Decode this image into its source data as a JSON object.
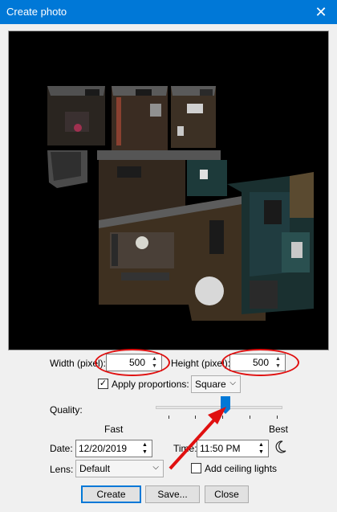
{
  "window": {
    "title": "Create photo",
    "close_glyph": "✕"
  },
  "preview": {
    "description_icon": "3d-floor-plan-render"
  },
  "size": {
    "width_label": "Width (pixel):",
    "width_value": "500",
    "height_label": "Height (pixel):",
    "height_value": "500"
  },
  "proportions": {
    "label": "Apply proportions:",
    "checked": true,
    "check_glyph": "✓",
    "option": "Square"
  },
  "quality": {
    "label": "Quality:",
    "min_label": "Fast",
    "max_label": "Best",
    "level_fraction": 0.55
  },
  "date": {
    "label": "Date:",
    "value": "12/20/2019"
  },
  "time": {
    "label": "Time:",
    "value": "11:50 PM",
    "icon": "moon-icon"
  },
  "lens": {
    "label": "Lens:",
    "value": "Default"
  },
  "ceiling": {
    "label": "Add ceiling lights",
    "checked": false
  },
  "buttons": {
    "create": "Create",
    "save": "Save...",
    "close": "Close"
  },
  "annotation_color": "#e01010",
  "accent": "#0078d7"
}
